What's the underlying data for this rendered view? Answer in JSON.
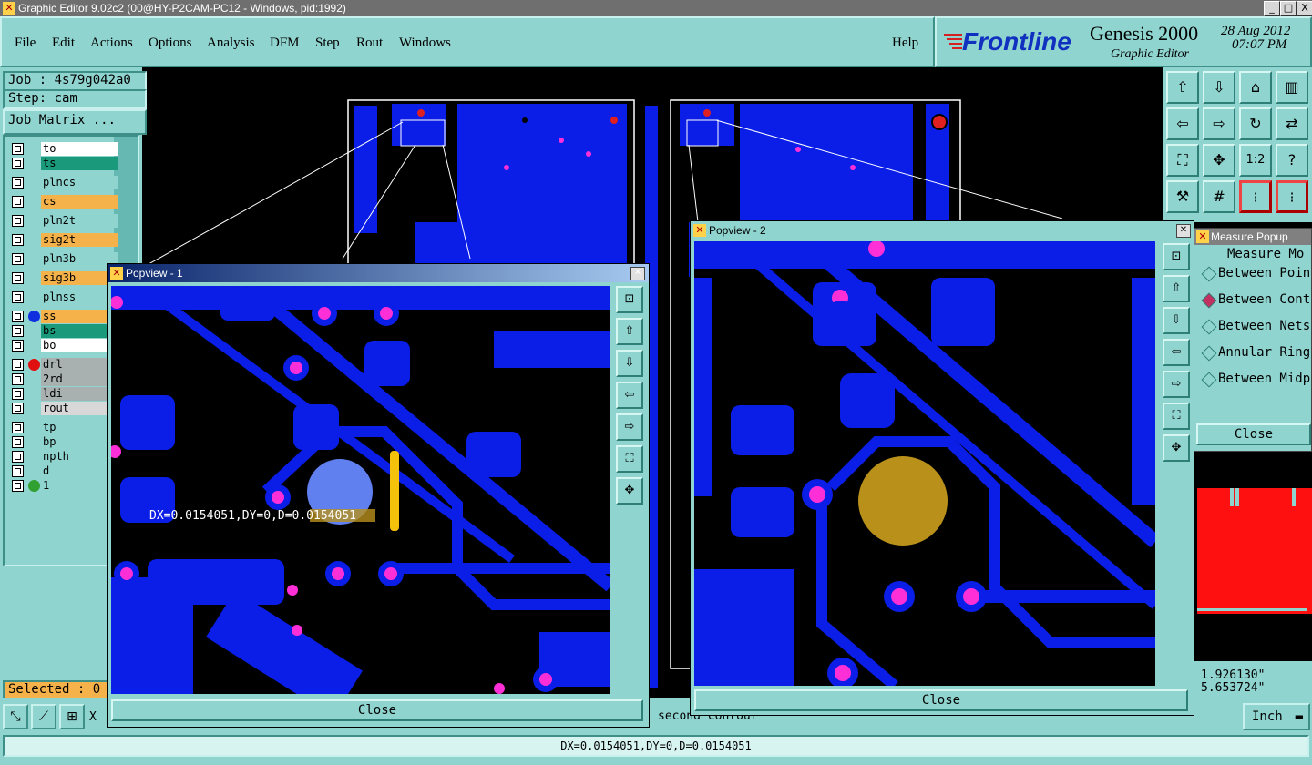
{
  "window": {
    "title": "Graphic Editor 9.02c2 (00@HY-P2CAM-PC12 - Windows, pid:1992)",
    "buttons": [
      "_",
      "□",
      "X"
    ]
  },
  "menu": {
    "items": [
      "File",
      "Edit",
      "Actions",
      "Options",
      "Analysis",
      "DFM",
      "Step",
      "Rout",
      "Windows"
    ],
    "help": "Help"
  },
  "brand": {
    "logo": "Frontline",
    "product": "Genesis 2000",
    "subtitle": "Graphic Editor",
    "date": "28 Aug 2012",
    "time": "07:07 PM"
  },
  "job": {
    "job_label": "Job : 4s79g042a0",
    "step_label": "Step: cam",
    "matrix_button": "Job Matrix ..."
  },
  "layers": [
    {
      "name": "to",
      "bg": "#ffffff",
      "dot": ""
    },
    {
      "name": "ts",
      "bg": "#1a9a7a",
      "dot": ""
    },
    {
      "name": "plncs",
      "bg": "#8fd4cf",
      "dot": ""
    },
    {
      "name": "cs",
      "bg": "#f5b24a",
      "dot": ""
    },
    {
      "name": "pln2t",
      "bg": "#8fd4cf",
      "dot": ""
    },
    {
      "name": "sig2t",
      "bg": "#f5b24a",
      "dot": ""
    },
    {
      "name": "pln3b",
      "bg": "#8fd4cf",
      "dot": ""
    },
    {
      "name": "sig3b",
      "bg": "#f5b24a",
      "dot": ""
    },
    {
      "name": "plnss",
      "bg": "#8fd4cf",
      "dot": ""
    },
    {
      "name": "ss",
      "bg": "#f5b24a",
      "dot": "#1030e0"
    },
    {
      "name": "bs",
      "bg": "#1a9a7a",
      "dot": ""
    },
    {
      "name": "bo",
      "bg": "#ffffff",
      "dot": ""
    },
    {
      "name": "drl",
      "bg": "#a8b0b0",
      "dot": "#e01010"
    },
    {
      "name": "2rd",
      "bg": "#a8b0b0",
      "dot": ""
    },
    {
      "name": "ldi",
      "bg": "#a8b0b0",
      "dot": ""
    },
    {
      "name": "rout",
      "bg": "#d8d8d8",
      "dot": ""
    },
    {
      "name": "tp",
      "bg": "#8fd4cf",
      "dot": ""
    },
    {
      "name": "bp",
      "bg": "#8fd4cf",
      "dot": ""
    },
    {
      "name": "npth",
      "bg": "#8fd4cf",
      "dot": ""
    },
    {
      "name": "d",
      "bg": "#8fd4cf",
      "dot": ""
    },
    {
      "name": "1",
      "bg": "#8fd4cf",
      "dot": "#30a030"
    }
  ],
  "status": {
    "selected": "Selected : 0",
    "x_label": "X",
    "prompt": "second contour",
    "measure": "DX=0.0154051,DY=0,D=0.0154051"
  },
  "popview1": {
    "title": "Popview - 1",
    "measure_text": "DX=0.0154051,DY=0,D=0.0154051",
    "close": "Close"
  },
  "popview2": {
    "title": "Popview - 2",
    "close": "Close"
  },
  "measure_popup": {
    "title": "Measure Popup",
    "mode_label": "Measure Mo",
    "modes": [
      "Between Poin",
      "Between Cont",
      "Between Nets",
      "Annular Ring",
      "Between Midp"
    ],
    "selected_mode": "Between Cont",
    "close": "Close",
    "coord_x": "1.926130\"",
    "coord_y": "5.653724\"",
    "units": "Inch"
  },
  "colors": {
    "panel": "#8fd4cf",
    "copper": "#0a1ee8",
    "pad": "#ff2fd8",
    "highlight": "#b8901a"
  }
}
